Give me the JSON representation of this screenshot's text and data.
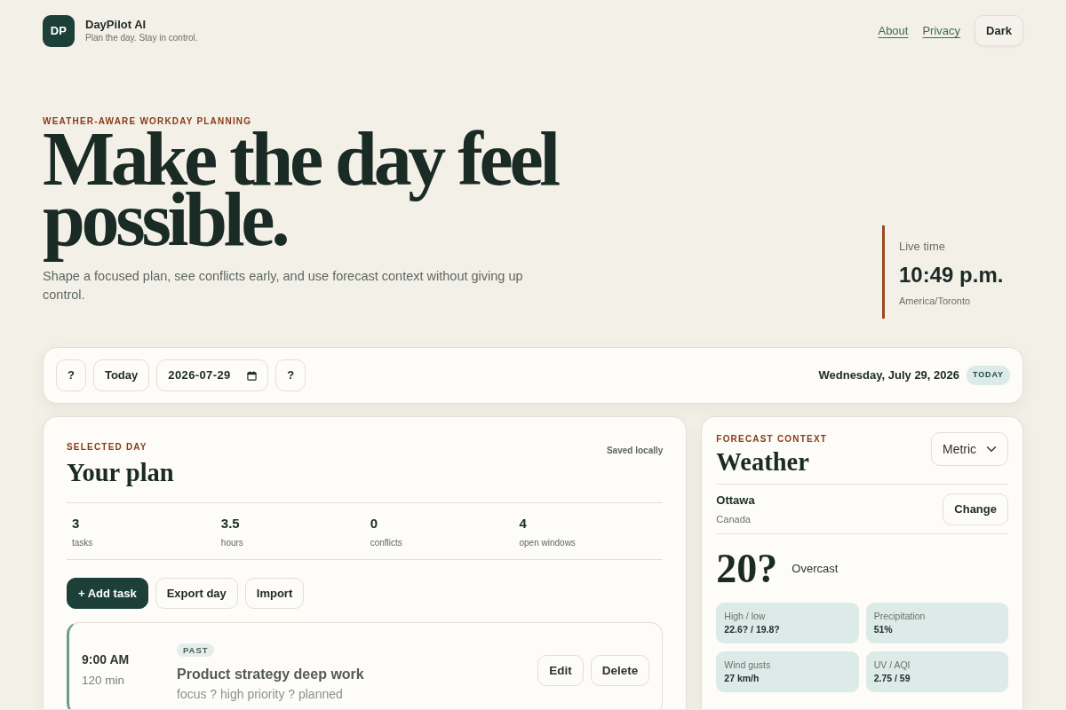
{
  "header": {
    "logo": "DP",
    "title": "DayPilot AI",
    "tagline": "Plan the day. Stay in control.",
    "links": [
      "About",
      "Privacy"
    ],
    "theme_button": "Dark"
  },
  "hero": {
    "eyebrow": "WEATHER-AWARE WORKDAY PLANNING",
    "headline": "Make the day feel possible.",
    "subtitle": "Shape a focused plan, see conflicts early, and use forecast context without giving up control.",
    "clock": {
      "label": "Live time",
      "time": "10:49 p.m.",
      "zone": "America/Toronto"
    }
  },
  "toolbar": {
    "prev_button": "?",
    "today_button": "Today",
    "date_value": "2026-07-29",
    "next_button": "?",
    "date_heading": "Wednesday, July 29, 2026",
    "badge": "TODAY"
  },
  "plan": {
    "eyebrow": "SELECTED DAY",
    "title": "Your plan",
    "save_status": "Saved locally",
    "stats": [
      {
        "value": "3",
        "label": "tasks"
      },
      {
        "value": "3.5",
        "label": "hours"
      },
      {
        "value": "0",
        "label": "conflicts"
      },
      {
        "value": "4",
        "label": "open windows"
      }
    ],
    "actions": [
      {
        "label": "+ Add task",
        "kind": "primary"
      },
      {
        "label": "Export day",
        "kind": "secondary"
      },
      {
        "label": "Import",
        "kind": "secondary"
      }
    ],
    "tasks": [
      {
        "time": "9:00 AM",
        "duration": "120 min",
        "badge": "PAST",
        "title": "Product strategy deep work",
        "meta": "focus ? high priority ? planned",
        "past": true,
        "buttons": [
          "Edit",
          "Delete"
        ]
      }
    ]
  },
  "weather": {
    "eyebrow": "FORECAST CONTEXT",
    "title": "Weather",
    "units": "Metric",
    "location": {
      "city": "Ottawa",
      "country": "Canada"
    },
    "change_button": "Change",
    "temperature": "20?",
    "condition": "Overcast",
    "metrics": [
      {
        "label": "High / low",
        "value": "22.6? / 19.8?"
      },
      {
        "label": "Precipitation",
        "value": "51%"
      },
      {
        "label": "Wind gusts",
        "value": "27 km/h"
      },
      {
        "label": "UV / AQI",
        "value": "2.75 / 59"
      }
    ]
  }
}
